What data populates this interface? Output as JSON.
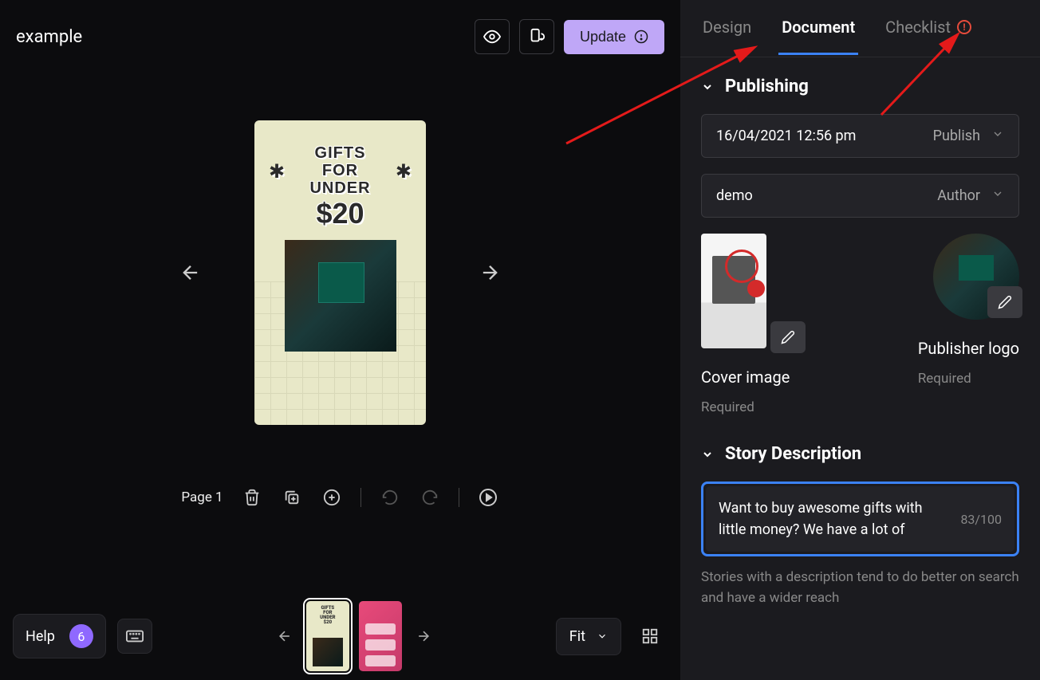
{
  "header": {
    "title": "example",
    "update_label": "Update"
  },
  "canvas": {
    "story_line1": "GIFTS",
    "story_line2": "FOR",
    "story_line3": "UNDER",
    "story_price": "$20"
  },
  "toolbar": {
    "page_label": "Page 1"
  },
  "bottom": {
    "help_label": "Help",
    "help_count": "6",
    "fit_label": "Fit"
  },
  "panel": {
    "tabs": {
      "design": "Design",
      "document": "Document",
      "checklist": "Checklist"
    },
    "publishing": {
      "title": "Publishing",
      "datetime": "16/04/2021 12:56 pm",
      "publish_label": "Publish",
      "author_value": "demo",
      "author_label": "Author",
      "cover_label": "Cover image",
      "cover_req": "Required",
      "logo_label": "Publisher logo",
      "logo_req": "Required"
    },
    "description": {
      "title": "Story Description",
      "text": "Want to buy awesome gifts with little money? We have a lot of",
      "count": "83/100",
      "help": "Stories with a description tend to do better on search and have a wider reach"
    }
  }
}
